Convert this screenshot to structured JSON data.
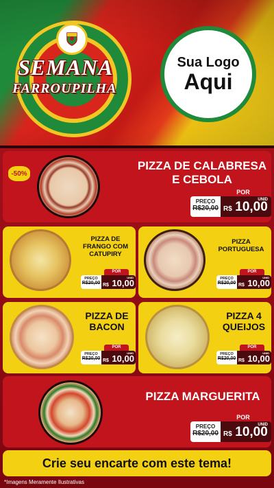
{
  "header": {
    "title_line1": "SEMANA",
    "title_line2": "FARROUPILHA",
    "logo_line1": "Sua Logo",
    "logo_line2": "Aqui"
  },
  "discount_badge": "-50%",
  "price_labels": {
    "por": "POR",
    "preco": "PREÇO",
    "old_price": "R$20,00",
    "currency": "R$",
    "new_price": "10,00",
    "unit": "UNID"
  },
  "products": [
    {
      "name": "PIZZA DE CALABRESA E CEBOLA"
    },
    {
      "name": "PIZZA DE FRANGO COM CATUPIRY"
    },
    {
      "name": "PIZZA PORTUGUESA"
    },
    {
      "name": "PIZZA DE BACON"
    },
    {
      "name": "PIZZA 4 QUEIJOS"
    },
    {
      "name": "PIZZA MARGUERITA"
    }
  ],
  "cta": "Crie seu encarte com este tema!",
  "footnote": "*Imagens Meramente Ilustrativas",
  "colors": {
    "red": "#c2141c",
    "yellow": "#f3d012",
    "green": "#1f8a3a",
    "dark": "#4b0b0e"
  }
}
